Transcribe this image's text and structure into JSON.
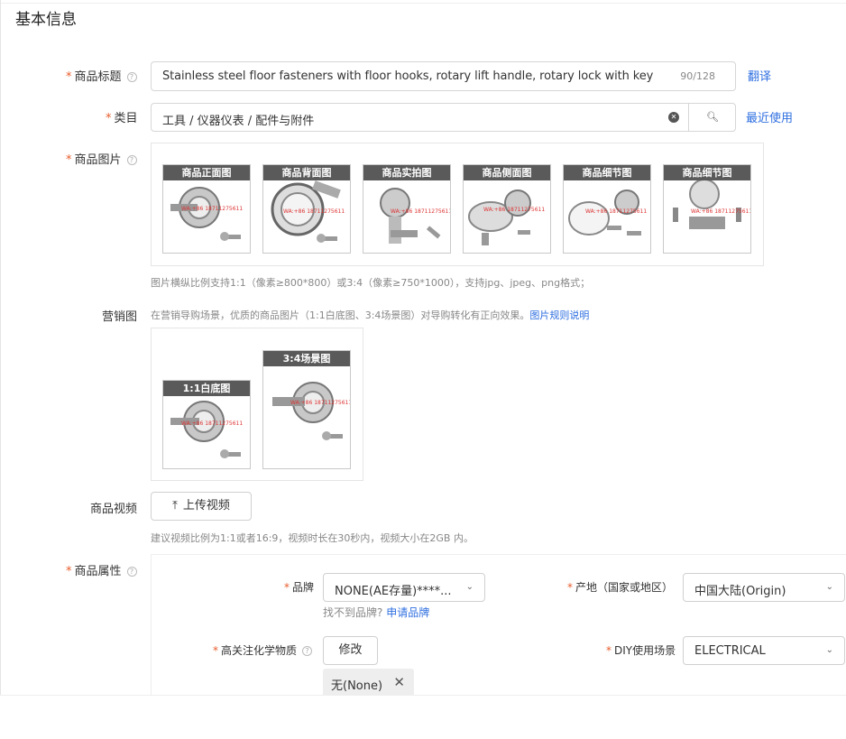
{
  "section": {
    "title": "基本信息"
  },
  "title_field": {
    "label": "商品标题",
    "value": "Stainless steel floor fasteners with floor hooks, rotary lift handle, rotary lock with key",
    "count": "90/128",
    "translate_link": "翻译"
  },
  "category_field": {
    "label": "类目",
    "value": "工具 / 仪器仪表 / 配件与附件",
    "recent_link": "最近使用"
  },
  "images_field": {
    "label": "商品图片",
    "thumbnails": [
      {
        "label": "商品正面图"
      },
      {
        "label": "商品背面图"
      },
      {
        "label": "商品实拍图"
      },
      {
        "label": "商品侧面图"
      },
      {
        "label": "商品细节图"
      },
      {
        "label": "商品细节图"
      }
    ],
    "hint": "图片横纵比例支持1:1（像素≥800*800）或3:4（像素≥750*1000），支持jpg、jpeg、png格式；"
  },
  "marketing_field": {
    "label": "营销图",
    "hint": "在营销导购场景，优质的商品图片（1:1白底图、3:4场景图）对导购转化有正向效果。",
    "rules_link": "图片规则说明",
    "thumbnails": [
      {
        "label": "1:1白底图"
      },
      {
        "label": "3:4场景图"
      }
    ]
  },
  "video_field": {
    "label": "商品视频",
    "upload_button": "上传视频",
    "hint": "建议视频比例为1:1或者16:9，视频时长在30秒内，视频大小在2GB 内。"
  },
  "attributes_field": {
    "label": "商品属性",
    "brand": {
      "label": "品牌",
      "value": "NONE(AE存量)****...",
      "not_found": "找不到品牌?",
      "apply_link": "申请品牌"
    },
    "origin": {
      "label": "产地（国家或地区）",
      "value": "中国大陆(Origin)"
    },
    "chemical": {
      "label": "高关注化学物质",
      "modify_button": "修改",
      "tag": "无(None)"
    },
    "diy": {
      "label": "DIY使用场景",
      "value": "ELECTRICAL"
    }
  },
  "colors": {
    "required": "#e85c2b",
    "link": "#2f6fe0",
    "thumb_label_bg": "#5a5a5a"
  }
}
